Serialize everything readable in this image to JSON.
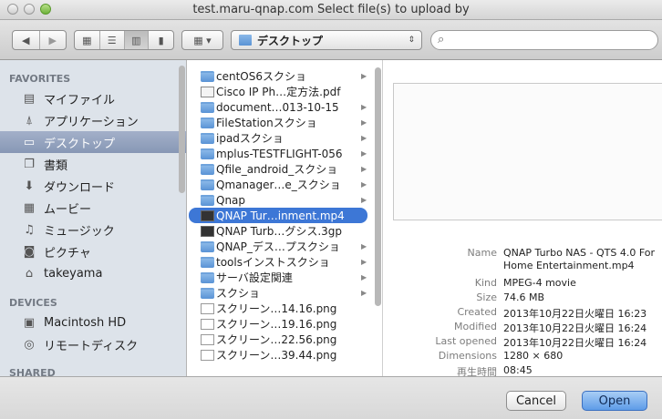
{
  "window": {
    "title": "test.maru-qnap.com Select file(s) to upload by"
  },
  "toolbar": {
    "location": "デスクトップ",
    "search_placeholder": ""
  },
  "sidebar": {
    "favorites_header": "FAVORITES",
    "favorites": [
      {
        "label": "マイファイル",
        "icon": "drive-icon"
      },
      {
        "label": "アプリケーション",
        "icon": "applications-icon"
      },
      {
        "label": "デスクトップ",
        "icon": "desktop-icon",
        "selected": true
      },
      {
        "label": "書類",
        "icon": "documents-icon"
      },
      {
        "label": "ダウンロード",
        "icon": "download-icon"
      },
      {
        "label": "ムービー",
        "icon": "movies-icon"
      },
      {
        "label": "ミュージック",
        "icon": "music-icon"
      },
      {
        "label": "ピクチャ",
        "icon": "pictures-icon"
      },
      {
        "label": "takeyama",
        "icon": "home-icon"
      }
    ],
    "devices_header": "DEVICES",
    "devices": [
      {
        "label": "Macintosh HD",
        "icon": "harddisk-icon"
      },
      {
        "label": "リモートディスク",
        "icon": "remote-disc-icon"
      }
    ],
    "shared_header": "SHARED"
  },
  "files": [
    {
      "name": "centOS6スクショ",
      "type": "folder",
      "arrow": true
    },
    {
      "name": "Cisco IP Ph…定方法.pdf",
      "type": "pdf",
      "arrow": false
    },
    {
      "name": "document…013-10-15",
      "type": "folder",
      "arrow": true
    },
    {
      "name": "FileStationスクショ",
      "type": "folder",
      "arrow": true
    },
    {
      "name": "ipadスクショ",
      "type": "folder",
      "arrow": true
    },
    {
      "name": "mplus-TESTFLIGHT-056",
      "type": "folder",
      "arrow": true
    },
    {
      "name": "Qfile_android_スクショ",
      "type": "folder",
      "arrow": true
    },
    {
      "name": "Qmanager…e_スクショ",
      "type": "folder",
      "arrow": true
    },
    {
      "name": "Qnap",
      "type": "folder",
      "arrow": true
    },
    {
      "name": "QNAP Tur…inment.mp4",
      "type": "video",
      "arrow": false,
      "selected": true
    },
    {
      "name": "QNAP Turb…グシス.3gp",
      "type": "video",
      "arrow": false
    },
    {
      "name": "QNAP_デス…プスクショ",
      "type": "folder",
      "arrow": true
    },
    {
      "name": "toolsインストスクショ",
      "type": "folder",
      "arrow": true
    },
    {
      "name": "サーバ設定関連",
      "type": "folder",
      "arrow": true
    },
    {
      "name": "スクショ",
      "type": "folder",
      "arrow": true
    },
    {
      "name": "スクリーン…14.16.png",
      "type": "image",
      "arrow": false
    },
    {
      "name": "スクリーン…19.16.png",
      "type": "image",
      "arrow": false
    },
    {
      "name": "スクリーン…22.56.png",
      "type": "image",
      "arrow": false
    },
    {
      "name": "スクリーン…39.44.png",
      "type": "image",
      "arrow": false
    }
  ],
  "info": [
    {
      "key": "Name",
      "value": "QNAP Turbo NAS - QTS 4.0 For",
      "value2": "Home Entertainment.mp4"
    },
    {
      "key": "Kind",
      "value": "MPEG-4 movie"
    },
    {
      "key": "Size",
      "value": "74.6 MB"
    },
    {
      "key": "Created",
      "value": "2013年10月22日火曜日 16:23"
    },
    {
      "key": "Modified",
      "value": "2013年10月22日火曜日 16:24"
    },
    {
      "key": "Last opened",
      "value": "2013年10月22日火曜日 16:24"
    },
    {
      "key": "Dimensions",
      "value": "1280 × 680"
    },
    {
      "key": "再生時間",
      "value": "08:45"
    }
  ],
  "buttons": {
    "cancel": "Cancel",
    "open": "Open"
  },
  "colors": {
    "selection": "#3d77d6",
    "sidebar_bg": "#dde3ea",
    "open_button": "#5e9ce8"
  }
}
